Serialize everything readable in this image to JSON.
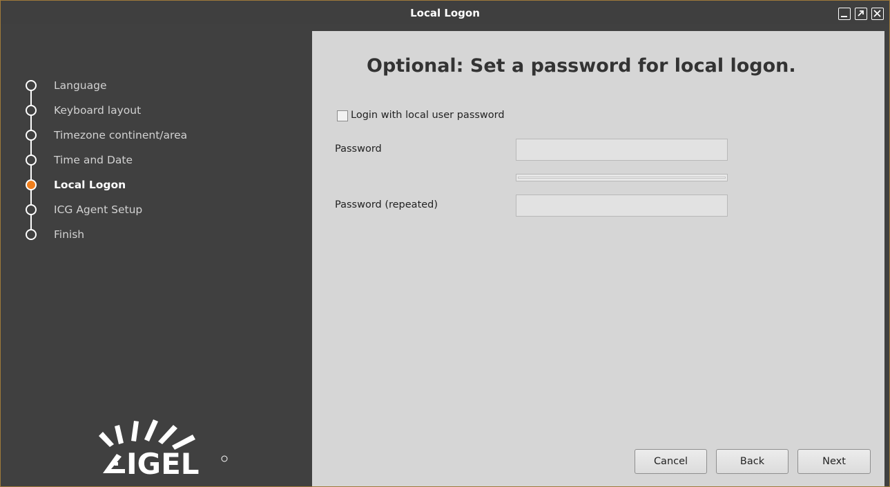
{
  "window": {
    "title": "Local Logon",
    "controls": [
      "minimize-icon",
      "maximize-icon",
      "close-icon"
    ]
  },
  "sidebar": {
    "steps": [
      {
        "label": "Language",
        "active": false
      },
      {
        "label": "Keyboard layout",
        "active": false
      },
      {
        "label": "Timezone continent/area",
        "active": false
      },
      {
        "label": "Time and Date",
        "active": false
      },
      {
        "label": "Local Logon",
        "active": true
      },
      {
        "label": "ICG Agent Setup",
        "active": false
      },
      {
        "label": "Finish",
        "active": false
      }
    ],
    "logo_text": "IGEL"
  },
  "main": {
    "heading": "Optional: Set a password for local logon.",
    "checkbox_label": "Login with local user password",
    "checkbox_checked": false,
    "password_label": "Password",
    "password_value": "",
    "password_repeat_label": "Password (repeated)",
    "password_repeat_value": ""
  },
  "buttons": {
    "cancel": "Cancel",
    "back": "Back",
    "next": "Next"
  },
  "colors": {
    "accent": "#f07f1d",
    "sidebar_bg": "#404040",
    "content_bg": "#d6d6d6"
  }
}
